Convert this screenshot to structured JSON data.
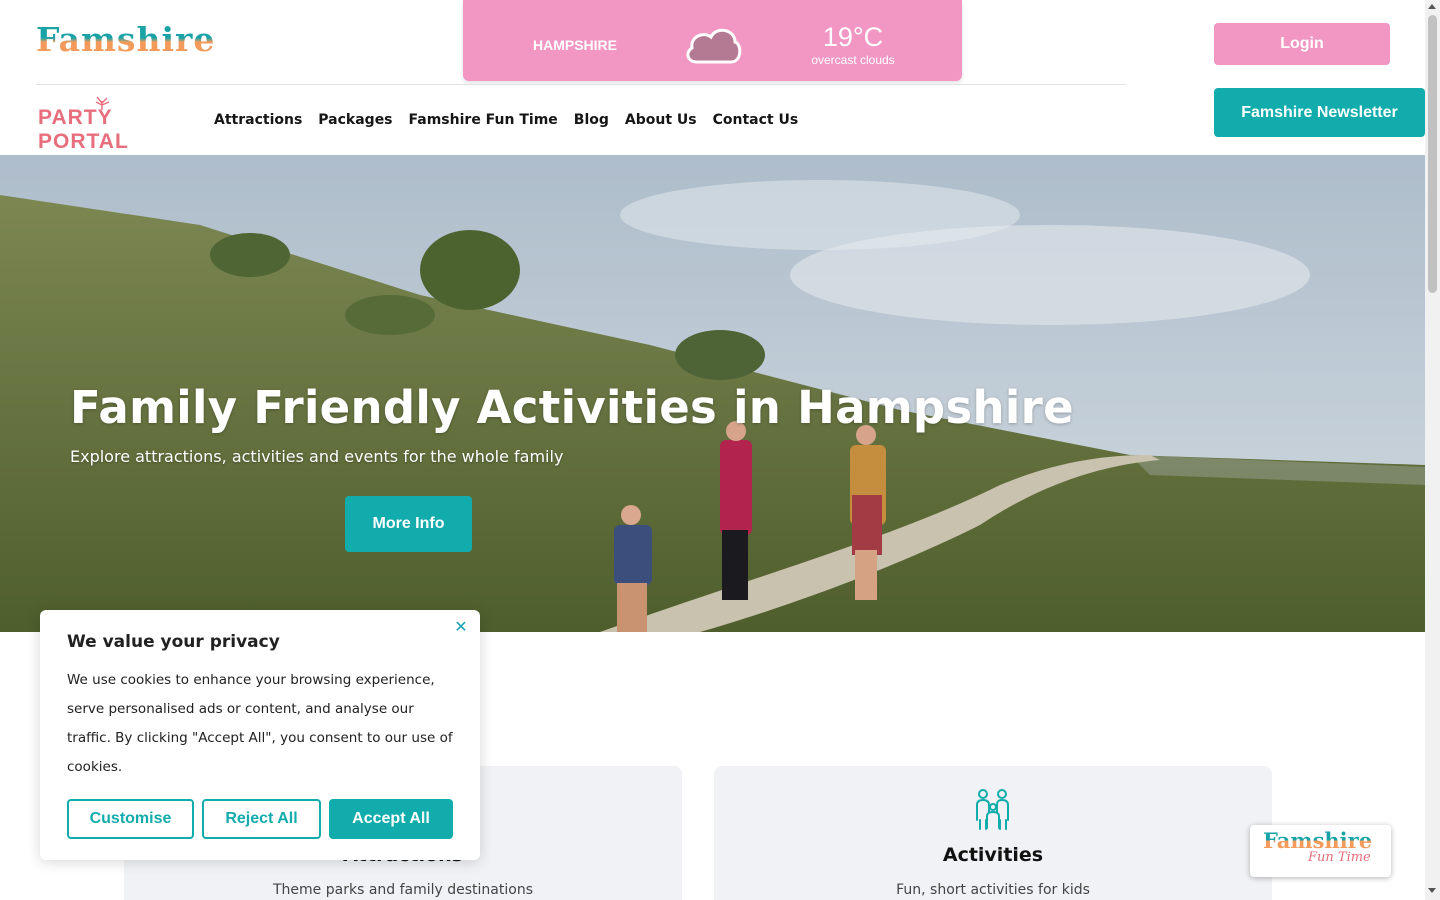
{
  "brand": {
    "name": "Famshire",
    "colors": {
      "pink": "#f296c4",
      "teal": "#13acac",
      "logo_teal": "#1aa3a6",
      "logo_orange": "#f49b5b"
    }
  },
  "weather": {
    "location": "HAMPSHIRE",
    "temperature": "19°C",
    "description": "overcast clouds",
    "icon": "cloud-icon"
  },
  "party_portal": {
    "label": "PARTY PORTAL"
  },
  "nav": {
    "items": [
      "Attractions",
      "Packages",
      "Famshire Fun Time",
      "Blog",
      "About Us",
      "Contact Us"
    ]
  },
  "header": {
    "login_label": "Login",
    "newsletter_label": "Famshire Newsletter"
  },
  "hero": {
    "title": "Family Friendly Activities in Hampshire",
    "subtitle": "Explore attractions, activities and events for the whole family",
    "button_label": "More Info"
  },
  "cards": [
    {
      "title": "Attractions",
      "description": "Theme parks and family destinations",
      "icon": "attractions-icon"
    },
    {
      "title": "Activities",
      "description": "Fun, short activities for kids",
      "icon": "family-icon"
    }
  ],
  "cookie": {
    "title": "We value your privacy",
    "text": "We use cookies to enhance your browsing experience, serve personalised ads or content, and analyse our traffic. By clicking \"Accept All\", you consent to our use of cookies.",
    "customise_label": "Customise",
    "reject_label": "Reject All",
    "accept_label": "Accept All",
    "close_icon": "close-icon"
  },
  "badge": {
    "top": "Famshire",
    "bottom": "Fun Time"
  }
}
